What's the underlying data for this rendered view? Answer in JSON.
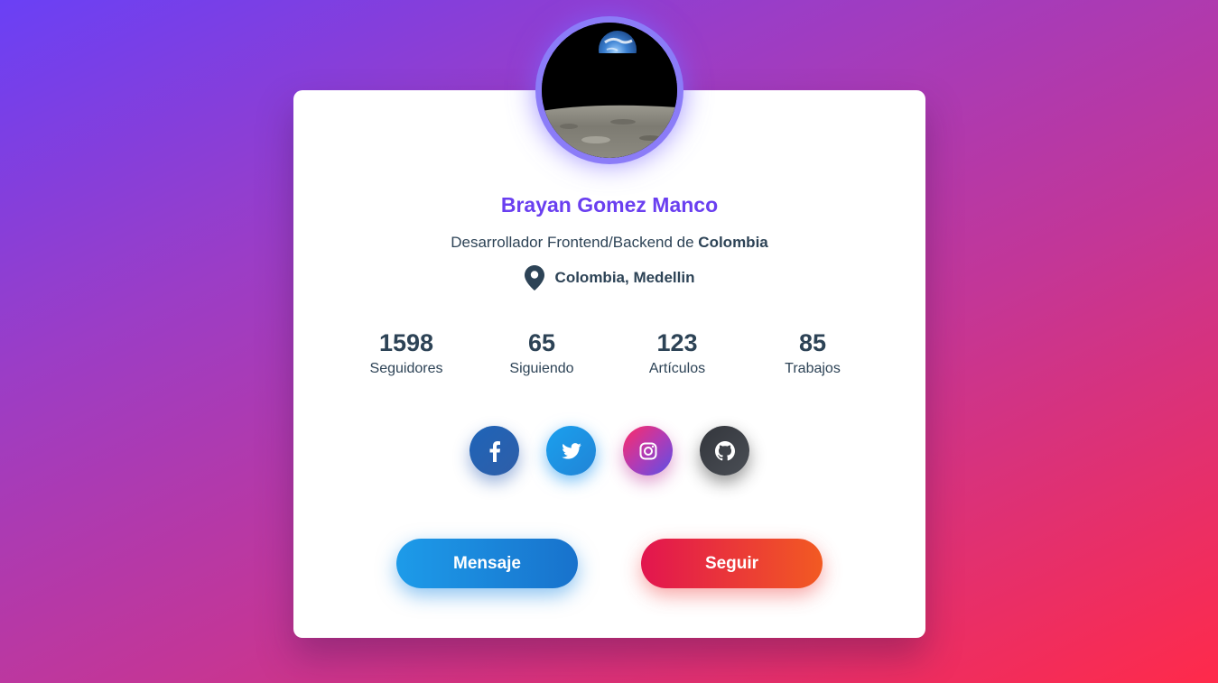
{
  "profile": {
    "name": "Brayan Gomez Manco",
    "role_prefix": "Desarrollador Frontend/Backend de ",
    "role_country": "Colombia",
    "location": "Colombia, Medellin",
    "location_icon": "map-pin-icon",
    "avatar_alt": "Earthrise"
  },
  "stats": [
    {
      "value": "1598",
      "label": "Seguidores"
    },
    {
      "value": "65",
      "label": "Siguiendo"
    },
    {
      "value": "123",
      "label": "Artículos"
    },
    {
      "value": "85",
      "label": "Trabajos"
    }
  ],
  "socials": [
    {
      "icon": "facebook-icon"
    },
    {
      "icon": "twitter-icon"
    },
    {
      "icon": "instagram-icon"
    },
    {
      "icon": "github-icon"
    }
  ],
  "actions": {
    "message_label": "Mensaje",
    "follow_label": "Seguir"
  },
  "colors": {
    "accent": "#6a3ff0",
    "text": "#2d4356",
    "message_button": "#1d9be9",
    "follow_button": "#e2154f"
  }
}
